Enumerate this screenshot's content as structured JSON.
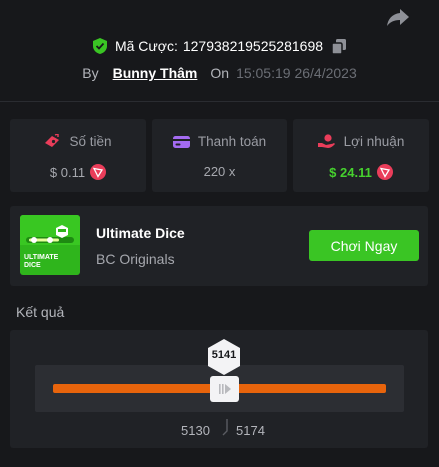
{
  "header": {
    "bet_id_label": "Mã Cược:",
    "bet_id": "127938219525281698",
    "by_label": "By",
    "user": "Bunny Thâm",
    "on_label": "On",
    "datetime": "15:05:19 26/4/2023"
  },
  "stats": [
    {
      "label": "Số tiền",
      "value": "$ 0.11",
      "icon": "money-icon",
      "coin": "trx-coin-icon"
    },
    {
      "label": "Thanh toán",
      "value": "220 x",
      "icon": "wallet-icon"
    },
    {
      "label": "Lợi nhuận",
      "value": "$ 24.11",
      "icon": "profit-hand-icon",
      "coin": "trx-coin-icon"
    }
  ],
  "game": {
    "title": "Ultimate Dice",
    "provider": "BC Originals",
    "play_label": "Chơi Ngay",
    "thumb_text_line1": "ULTIMATE",
    "thumb_text_line2": "DICE"
  },
  "result": {
    "label": "Kết quả",
    "value": "5141",
    "range_low": "5130",
    "range_high": "5174"
  },
  "colors": {
    "background": "#17181b",
    "card": "#202226",
    "accent_green": "#3ac524",
    "profit_green": "#46d12e",
    "slider_orange": "#e8640c",
    "coin_red": "#ea3d5a"
  }
}
